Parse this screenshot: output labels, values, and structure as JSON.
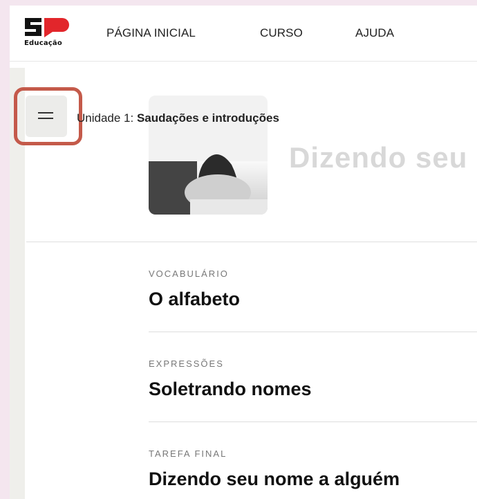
{
  "brand": {
    "logo_text": "Educação"
  },
  "nav": {
    "home": "PÁGINA INICIAL",
    "course": "CURSO",
    "help": "AJUDA"
  },
  "unit": {
    "prefix": "Unidade 1:",
    "name": "Saudações e introduções"
  },
  "hero": {
    "title": "Dizendo seu"
  },
  "lessons": [
    {
      "category": "VOCABULÁRIO",
      "title": "O alfabeto"
    },
    {
      "category": "EXPRESSÕES",
      "title": "Soletrando nomes"
    },
    {
      "category": "TAREFA FINAL",
      "title": "Dizendo seu nome a alguém"
    }
  ],
  "colors": {
    "highlight": "#c45a4a",
    "brand_red": "#e2262b"
  }
}
